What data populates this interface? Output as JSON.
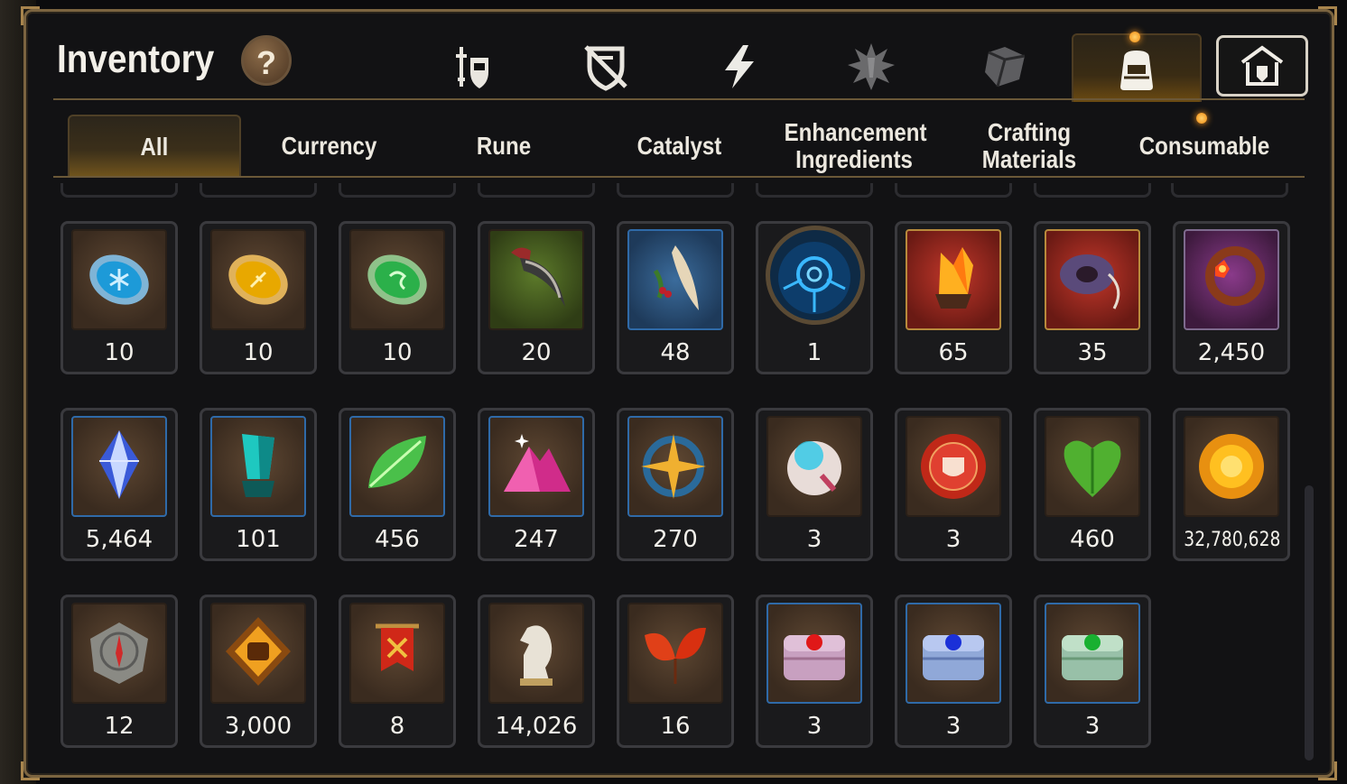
{
  "title": "Inventory",
  "help_label": "?",
  "top_tabs": [
    {
      "icon": "sword-shield-icon",
      "active": false
    },
    {
      "icon": "broken-shield-icon",
      "active": false
    },
    {
      "icon": "lightning-icon",
      "active": false
    },
    {
      "icon": "starburst-emblem-icon",
      "active": false
    },
    {
      "icon": "cube-icon",
      "active": false
    },
    {
      "icon": "backpack-icon",
      "active": true
    },
    {
      "icon": "shop-house-icon",
      "active": false
    }
  ],
  "sub_tabs": [
    "All",
    "Currency",
    "Rune",
    "Catalyst",
    "Enhancement Ingredients",
    "Crafting Materials",
    "Consumable"
  ],
  "active_sub_tab": "All",
  "items": [
    {
      "icon": "blue-rune-stone-icon",
      "qty": "10"
    },
    {
      "icon": "gold-rune-stone-icon",
      "qty": "10"
    },
    {
      "icon": "green-rune-stone-icon",
      "qty": "10"
    },
    {
      "icon": "claw-icon",
      "qty": "20"
    },
    {
      "icon": "feather-root-icon",
      "qty": "48"
    },
    {
      "icon": "blue-portal-disc-icon",
      "qty": "1"
    },
    {
      "icon": "amber-crystal-icon",
      "qty": "65"
    },
    {
      "icon": "ring-amulet-icon",
      "qty": "35"
    },
    {
      "icon": "flower-ring-icon",
      "qty": "2,450"
    },
    {
      "icon": "blue-gem-icon",
      "qty": "5,464"
    },
    {
      "icon": "teal-crystal-icon",
      "qty": "101"
    },
    {
      "icon": "leaf-icon",
      "qty": "456"
    },
    {
      "icon": "pink-crystal-pile-icon",
      "qty": "247"
    },
    {
      "icon": "star-compass-icon",
      "qty": "270"
    },
    {
      "icon": "orb-device-icon",
      "qty": "3"
    },
    {
      "icon": "red-seal-icon",
      "qty": "3"
    },
    {
      "icon": "green-heart-icon",
      "qty": "460"
    },
    {
      "icon": "gold-coin-icon",
      "qty": "32,780,628"
    },
    {
      "icon": "compass-stone-icon",
      "qty": "12"
    },
    {
      "icon": "fist-emblem-icon",
      "qty": "3,000"
    },
    {
      "icon": "war-banner-icon",
      "qty": "8"
    },
    {
      "icon": "chess-knight-icon",
      "qty": "14,026"
    },
    {
      "icon": "autumn-leaves-icon",
      "qty": "16"
    },
    {
      "icon": "ruby-chest-icon",
      "qty": "3"
    },
    {
      "icon": "sapphire-chest-icon",
      "qty": "3"
    },
    {
      "icon": "emerald-chest-icon",
      "qty": "3"
    }
  ],
  "colors": {
    "panel_border": "#7b6440",
    "active_tab_glow": "#f0a020",
    "text": "#f2f0ea",
    "notification_dot": "#f59a1a"
  }
}
